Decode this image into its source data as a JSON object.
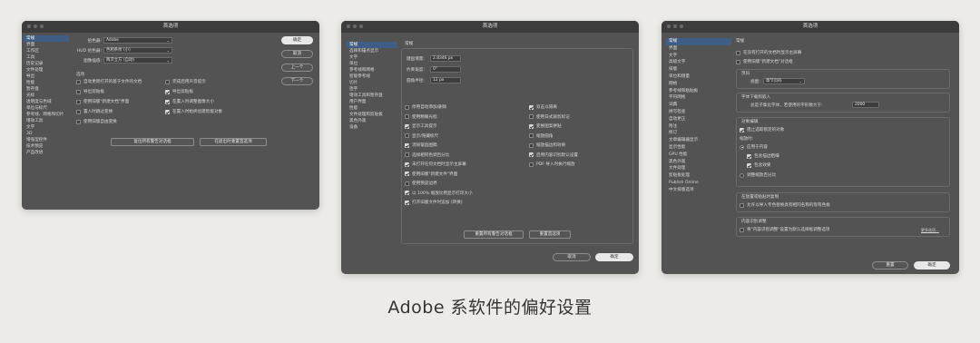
{
  "caption": "Adobe 系软件的偏好设置",
  "w1": {
    "title": "首选项",
    "sidebar": [
      "常规",
      "界面",
      "工作区",
      "工具",
      "历史记录",
      "文件处理",
      "导出",
      "性能",
      "暂存盘",
      "光标",
      "透明度与色域",
      "单位与标尺",
      "参考线、网格和切片",
      "增效工具",
      "文字",
      "3D",
      "增强型控件",
      "技术预览",
      "产品改进"
    ],
    "fields": [
      {
        "label": "拾色器:",
        "value": "Adobe"
      },
      {
        "label": "HUD 拾色器:",
        "value": "色相条纹 (小)"
      },
      {
        "label": "图像插值:",
        "value": "两次立方 (自动)"
      }
    ],
    "options_title": "选项",
    "left_checks": [
      {
        "label": "自动更新打开的基于文件的文档",
        "on": false
      },
      {
        "label": "导出剪贴板",
        "on": false
      },
      {
        "label": "使用旧版\"新建文档\"界面",
        "on": false
      },
      {
        "label": "置入时跳过变换",
        "on": false
      },
      {
        "label": "使用旧版自由变换",
        "on": false
      }
    ],
    "right_checks": [
      {
        "label": "完成后用声音提示",
        "on": false
      },
      {
        "label": "导出剪贴板",
        "on": true
      },
      {
        "label": "在置入时调整图像大小",
        "on": true
      },
      {
        "label": "在置入时始终创建智能对象",
        "on": true
      }
    ],
    "reset_warnings": "复位所有警告对话框",
    "reset_prefs": "在退出时重置首选项",
    "buttons": [
      "确定",
      "取消",
      "上一个",
      "下一个"
    ]
  },
  "w2": {
    "title": "首选项",
    "sidebar": [
      "常规",
      "选择和锚点显示",
      "文字",
      "单位",
      "参考线和网格",
      "智能参考线",
      "切片",
      "连字",
      "增效工具和暂存盘",
      "用户界面",
      "性能",
      "文件处理和剪贴板",
      "黑色外观",
      "设备"
    ],
    "section": "常规",
    "fields": [
      {
        "label": "键盘增量:",
        "value": "2.8346 px"
      },
      {
        "label": "约束角度:",
        "value": "0°"
      },
      {
        "label": "圆角半径:",
        "value": "12 px"
      }
    ],
    "left_checks": [
      {
        "label": "停用自动添加/删除",
        "on": false
      },
      {
        "label": "使用精确光标",
        "on": false
      },
      {
        "label": "显示工具提示",
        "on": true
      },
      {
        "label": "显示/隐藏标尺",
        "on": false
      },
      {
        "label": "消除锯齿图稿",
        "on": true
      },
      {
        "label": "选择相同色调百分比",
        "on": false
      },
      {
        "label": "未打开任何文档时显示主屏幕",
        "on": true
      },
      {
        "label": "使用旧版\"新建文件\"界面",
        "on": true
      },
      {
        "label": "使用预览边界",
        "on": false
      },
      {
        "label": "以 100% 缩放比例显示打印大小",
        "on": true
      },
      {
        "label": "打开旧版文件时追加 [转换]",
        "on": true
      }
    ],
    "right_checks": [
      {
        "label": "双击以隔离",
        "on": true
      },
      {
        "label": "使用日式裁剪标记",
        "on": false
      },
      {
        "label": "变换图案拼贴",
        "on": true
      },
      {
        "label": "缩放圆角",
        "on": false
      },
      {
        "label": "缩放描边和效果",
        "on": false
      },
      {
        "label": "启用内容识别默认设置",
        "on": true
      },
      {
        "label": "PDF 导入时执行缩放",
        "on": false
      }
    ],
    "reset_warnings": "重置所有警告对话框",
    "reset_prefs": "重置首选项",
    "buttons": [
      "取消",
      "确定"
    ]
  },
  "w3": {
    "title": "首选项",
    "sidebar": [
      "常规",
      "界面",
      "文字",
      "高级文字",
      "排版",
      "单位和增量",
      "网格",
      "参考线和粘贴板",
      "字符网格",
      "词典",
      "拼写检查",
      "自动更正",
      "附注",
      "修订",
      "文章编辑器显示",
      "显示性能",
      "GPU 性能",
      "黑色外观",
      "文件处理",
      "剪贴板处理",
      "Publish Online",
      "中文排版选项"
    ],
    "section": "常规",
    "top_checks": [
      {
        "label": "在没有打开的文档时显示主屏幕",
        "on": false
      },
      {
        "label": "使用旧版\"新建文档\"对话框",
        "on": false
      }
    ],
    "page_group": "页码",
    "view_label": "视图:",
    "view_value": "章节页码",
    "font_group": "字体下载和嵌入",
    "font_label": "总是子集化字体，若使用的字形数大于:",
    "font_value": "2000",
    "obj_group": "对象编辑",
    "obj_check": {
      "label": "阻止选取锁定的对象",
      "on": true
    },
    "scale_group": "缩放时:",
    "scale_radio1": "应用于内容",
    "scale_sub1": {
      "label": "包含描边粗细",
      "on": true
    },
    "scale_sub2": {
      "label": "包含效果",
      "on": true
    },
    "scale_radio2": "调整缩放百分比",
    "dup_group": "在放置或粘贴时复制",
    "dup_check": {
      "label": "允许以导入专色替换具有相同名称的现有色板",
      "on": false
    },
    "cs_group": "内容识别调整",
    "cs_check": {
      "label": "将\"内容识别调整\"设置为默认选择框调整选项",
      "on": false
    },
    "cs_link": "更多选项...",
    "buttons": [
      "重置",
      "确定"
    ]
  }
}
